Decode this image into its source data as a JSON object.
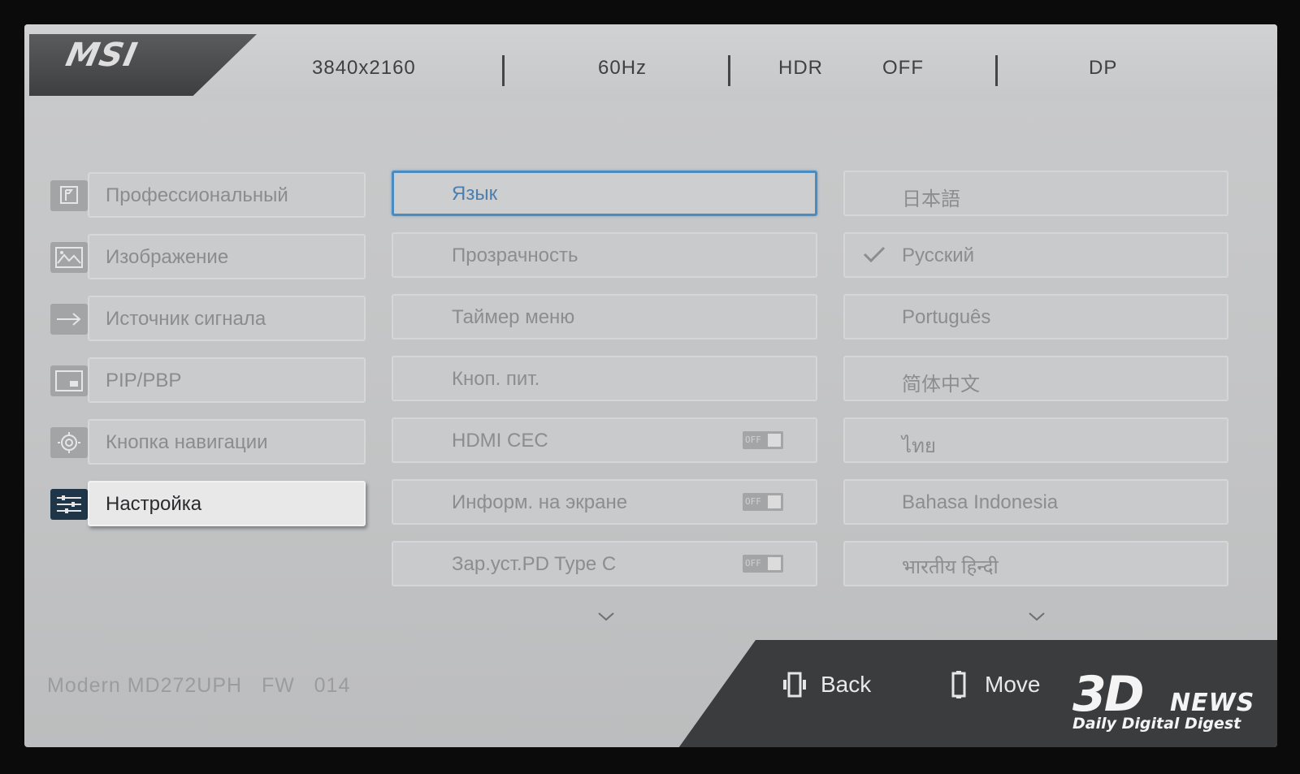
{
  "brand": "MSI",
  "header": {
    "resolution": "3840x2160",
    "refresh": "60Hz",
    "hdr_label": "HDR",
    "hdr_value": "OFF",
    "input": "DP"
  },
  "main_menu": [
    {
      "label": "Профессиональный",
      "icon": "flag-icon"
    },
    {
      "label": "Изображение",
      "icon": "image-icon"
    },
    {
      "label": "Источник сигнала",
      "icon": "input-arrow-icon"
    },
    {
      "label": "PIP/PBP",
      "icon": "pip-icon"
    },
    {
      "label": "Кнопка навигации",
      "icon": "navigation-key-icon"
    },
    {
      "label": "Настройка",
      "icon": "settings-sliders-icon",
      "active": true
    }
  ],
  "sub_menu": [
    {
      "label": "Язык",
      "selected": true
    },
    {
      "label": "Прозрачность"
    },
    {
      "label": "Таймер меню"
    },
    {
      "label": "Кноп. пит."
    },
    {
      "label": "HDMI CEC",
      "toggle": "OFF"
    },
    {
      "label": "Информ. на экране",
      "toggle": "OFF"
    },
    {
      "label": "Зар.уст.PD Type C",
      "toggle": "OFF"
    }
  ],
  "languages": [
    {
      "label": "日本語"
    },
    {
      "label": "Русский",
      "checked": true
    },
    {
      "label": "Português"
    },
    {
      "label": "简体中文"
    },
    {
      "label": "ไทย"
    },
    {
      "label": "Bahasa Indonesia"
    },
    {
      "label": "भारतीय    हिन्दी"
    }
  ],
  "footer": {
    "model": "Modern MD272UPH",
    "fw_label": "FW",
    "fw_value": "014",
    "back_label": "Back",
    "move_label": "Move"
  },
  "watermark": {
    "logo": "3D",
    "news": "NEWS",
    "tagline": "Daily Digital Digest"
  },
  "colors": {
    "accent": "#4a8cbf",
    "active_icon_bg": "#1f3548"
  }
}
